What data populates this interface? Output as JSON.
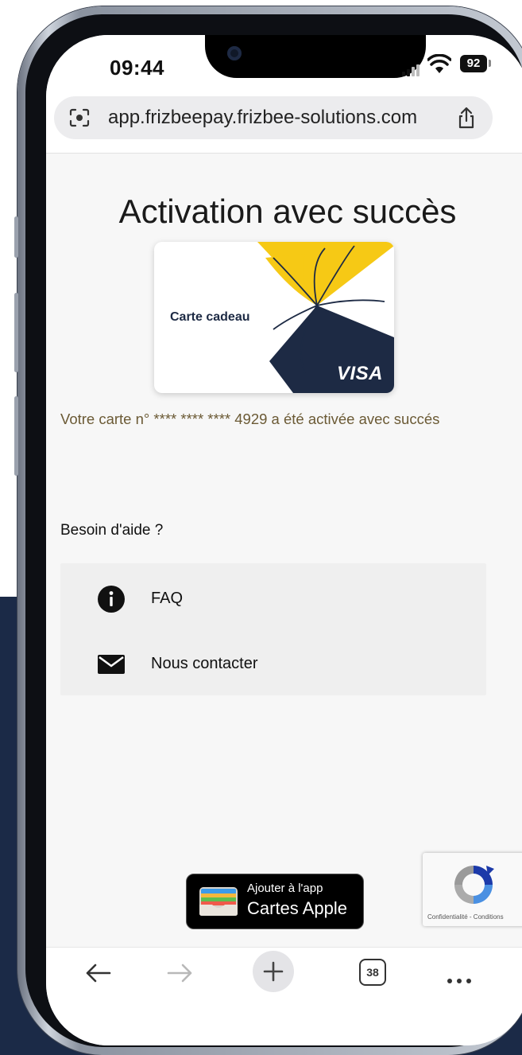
{
  "status": {
    "time": "09:44",
    "battery": "92"
  },
  "browser": {
    "url": "app.frizbeepay.frizbee-solutions.com",
    "tab_count": "38"
  },
  "page": {
    "title": "Activation avec succès",
    "card": {
      "label": "Carte cadeau",
      "brand": "VISA"
    },
    "message": "Votre carte n° **** **** **** 4929 a été activée avec succés",
    "help": {
      "title": "Besoin d'aide ?",
      "items": [
        {
          "label": "FAQ",
          "icon": "info-icon"
        },
        {
          "label": "Nous contacter",
          "icon": "mail-icon"
        }
      ]
    },
    "wallet": {
      "line1": "Ajouter à l'app",
      "line2": "Cartes Apple"
    },
    "recaptcha": {
      "text": "Confidentialité - Conditions"
    }
  },
  "colors": {
    "navy": "#1b2a47",
    "card_yellow": "#f6c915",
    "card_navy": "#1d2a44",
    "message_text": "#6b5a35"
  }
}
